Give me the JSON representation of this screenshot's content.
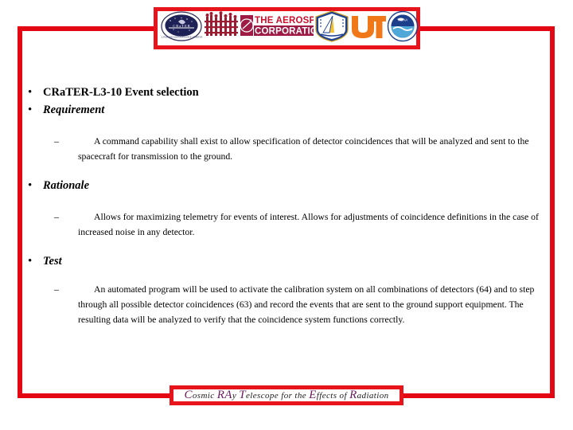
{
  "slide": {
    "frame_color": "#e30613",
    "background": "#ffffff"
  },
  "logo_banner": {
    "border_color": "#e8141b",
    "logos": [
      {
        "name": "crater-mission-seal-logo",
        "alt": "CRaTER mission seal"
      },
      {
        "name": "boston-university-logo",
        "alt": "Boston University"
      },
      {
        "name": "aerospace-corporation-logo",
        "alt": "THE AEROSPACE CORPORATION"
      },
      {
        "name": "air-force-research-laboratory-logo",
        "alt": "Air Force Research Laboratory"
      },
      {
        "name": "university-of-tennessee-logo",
        "alt": "UT"
      },
      {
        "name": "noaa-logo",
        "alt": "NOAA"
      }
    ]
  },
  "content": {
    "bullet_glyph": "•",
    "dash_glyph": "–",
    "items": [
      {
        "id": "title",
        "level": 1,
        "style": "bold",
        "text": "CRaTER-L3-10 Event selection"
      },
      {
        "id": "requirement-heading",
        "level": 1,
        "style": "bold-italic",
        "text": "Requirement"
      },
      {
        "id": "requirement-body",
        "level": 2,
        "text": "A command capability shall exist to allow specification of detector coincidences that will be analyzed and sent to the spacecraft for transmission to the ground."
      },
      {
        "id": "rationale-heading",
        "level": 1,
        "style": "bold-italic",
        "text": "Rationale"
      },
      {
        "id": "rationale-body",
        "level": 2,
        "text": "Allows for maximizing telemetry for events of interest.  Allows for adjustments of coincidence definitions in the case of increased noise in any detector."
      },
      {
        "id": "test-heading",
        "level": 1,
        "style": "bold-italic",
        "text": "Test"
      },
      {
        "id": "test-body",
        "level": 2,
        "text": "An automated program will be used to activate the calibration system on all combinations of detectors (64) and to step through all possible detector coincidences (63) and record the events that are sent to the ground support equipment.  The resulting data will be analyzed to verify that the coincidence system functions correctly."
      }
    ]
  },
  "footer": {
    "border_color": "#e8141b",
    "cap_color": "#6b1a5e",
    "segments": [
      {
        "cap": "C",
        "rest": "osmic "
      },
      {
        "cap": "RA",
        "rest": "y "
      },
      {
        "cap": "T",
        "rest": "elescope for the "
      },
      {
        "cap": "E",
        "rest": "ffects of "
      },
      {
        "cap": "R",
        "rest": "adiation"
      }
    ],
    "full_text": "Cosmic RAy Telescope for the Effects of Radiation"
  }
}
